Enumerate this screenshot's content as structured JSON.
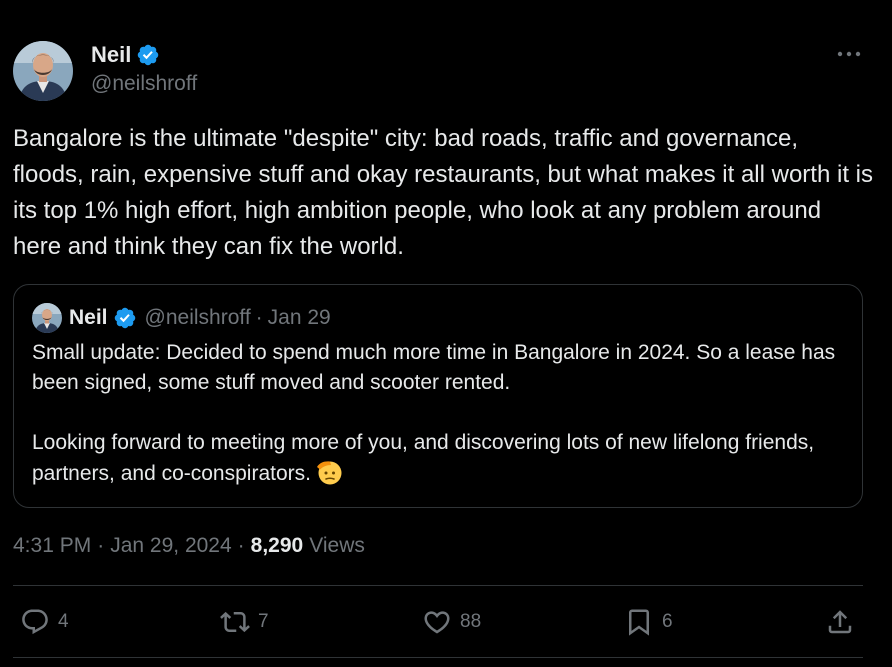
{
  "author": {
    "name": "Neil",
    "handle": "@neilshroff",
    "verified_color": "#1d9bf0"
  },
  "tweet": {
    "text": "Bangalore is the ultimate \"despite\" city: bad roads, traffic and governance, floods, rain, expensive stuff and okay restaurants, but what makes it all worth it is its top 1% high effort, high ambition people, who look at any problem around here and think they can fix the world."
  },
  "quote": {
    "name": "Neil",
    "handle": "@neilshroff",
    "separator": "·",
    "date": "Jan 29",
    "para1": "Small update: Decided to spend much more time in Bangalore in 2024. So a lease has been signed, some stuff moved and scooter rented.",
    "para2": "Looking forward to meeting more of you, and discovering lots of new lifelong friends, partners, and co-conspirators.",
    "emoji": "saluting-face"
  },
  "meta": {
    "time": "4:31 PM",
    "separator": "·",
    "date": "Jan 29, 2024",
    "views_count": "8,290",
    "views_label": "Views"
  },
  "actions": {
    "replies": "4",
    "reposts": "7",
    "likes": "88",
    "bookmarks": "6"
  },
  "icons": {
    "reply": "reply-icon",
    "repost": "repost-icon",
    "like": "heart-icon",
    "bookmark": "bookmark-icon",
    "share": "share-icon",
    "more": "more-icon",
    "verified": "verified-badge-icon"
  },
  "colors": {
    "background": "#000000",
    "text": "#e7e9ea",
    "secondary": "#71767b",
    "border": "#2f3336",
    "accent": "#1d9bf0"
  }
}
